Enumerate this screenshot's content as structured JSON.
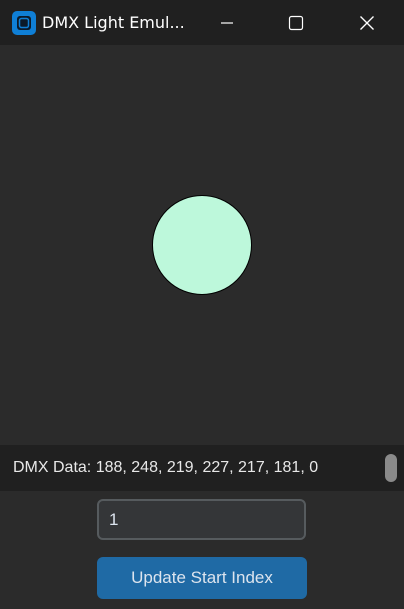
{
  "window": {
    "title": "DMX Light Emul...",
    "icon": "app-icon",
    "controls": [
      "minimize-icon",
      "maximize-icon",
      "close-icon"
    ]
  },
  "light": {
    "color": "#bdf8db"
  },
  "dmx": {
    "text": "DMX Data: 188, 248, 219, 227, 217, 181, 0"
  },
  "start_index": {
    "value": "1"
  },
  "update_button": {
    "label": "Update Start Index"
  },
  "colors": {
    "background": "#2b2b2b",
    "titlebar": "#202020",
    "accent": "#1f6aa5"
  }
}
